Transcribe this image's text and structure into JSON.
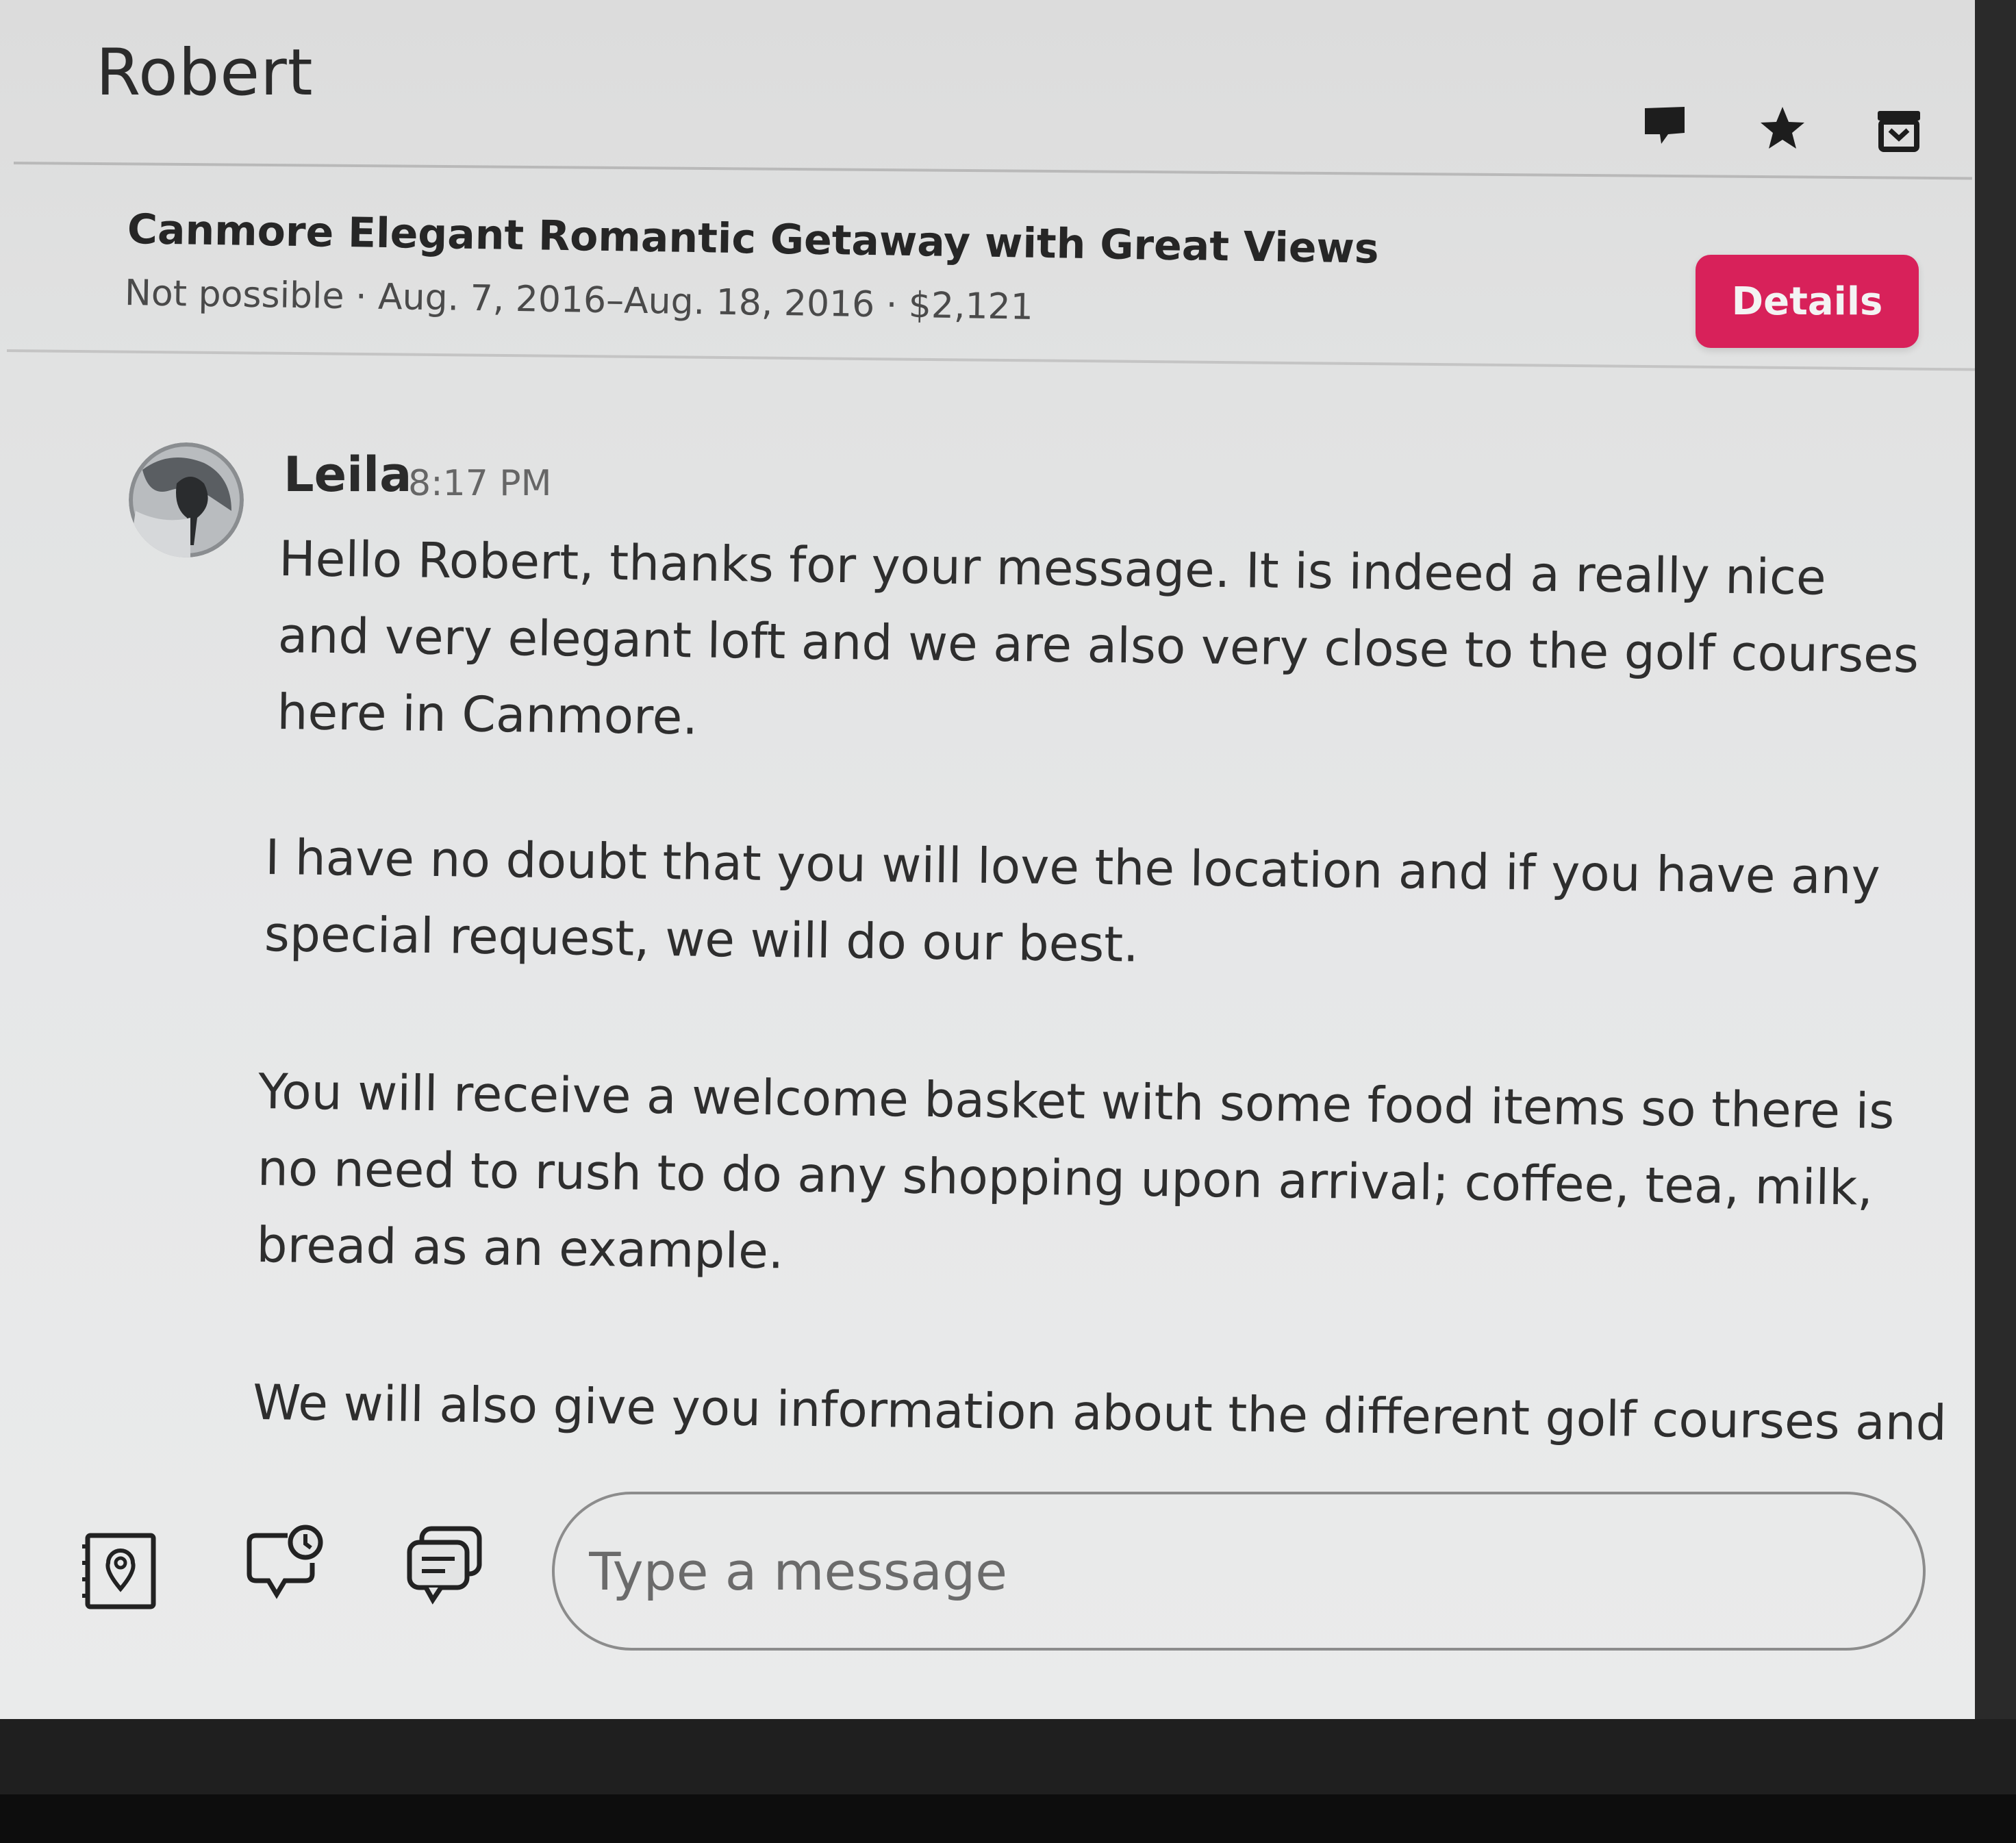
{
  "header": {
    "contact_name": "Robert",
    "icons": [
      "flag-icon",
      "star-icon",
      "archive-icon"
    ]
  },
  "listing": {
    "title": "Canmore Elegant Romantic Getaway with Great Views",
    "meta": "Not possible · Aug. 7, 2016–Aug. 18, 2016 · $2,121",
    "details_label": "Details"
  },
  "message": {
    "sender": "Leila",
    "time": "8:17 PM",
    "paragraphs": [
      "Hello Robert, thanks for your message. It is indeed a really nice and very elegant loft and we are also very close to the golf courses here in Canmore.",
      "I have no doubt that you will love the location and if you have any special request, we will do our best.",
      "You will receive a welcome basket with some food items so there is no need to rush to do any shopping upon arrival; coffee, tea, milk, bread as an example.",
      "We will also give you information about the different golf courses and"
    ]
  },
  "composer": {
    "placeholder": "Type a message",
    "tools": [
      "guidebook-icon",
      "scheduled-message-icon",
      "quick-reply-icon"
    ]
  },
  "colors": {
    "accent": "#d8215a",
    "screen_bg": "#e3e4e4",
    "text": "#2b2b2b"
  }
}
